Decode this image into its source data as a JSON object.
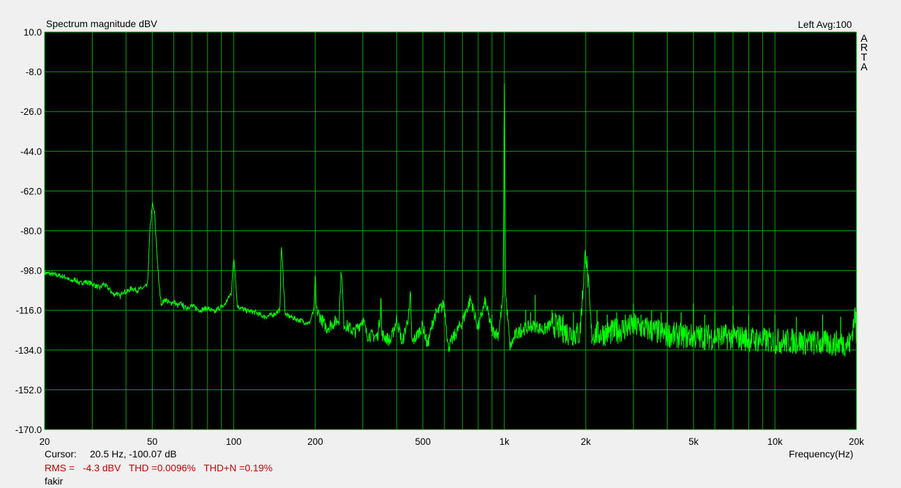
{
  "title": "Spectrum magnitude dBV",
  "channel_info": "Left  Avg:100",
  "brand": [
    "A",
    "R",
    "T",
    "A"
  ],
  "cursor_label": "Cursor:",
  "cursor_value": "20.5 Hz, -100.07 dB",
  "measurements": "RMS =   -4.3 dBV   THD =0.0096%   THD+N =0.19%",
  "comment": "fakir",
  "colors": {
    "plot_bg": "#000000",
    "grid": "#00aa00",
    "trace": "#00ff00",
    "measure_text": "#c00000"
  },
  "chart_data": {
    "type": "line",
    "xlabel": "Frequency(Hz)",
    "ylabel": "",
    "x_scale": "log",
    "xlim": [
      20,
      20000
    ],
    "ylim": [
      -170,
      10
    ],
    "grid": true,
    "y_ticks": [
      "10.0",
      "-8.0",
      "-26.0",
      "-44.0",
      "-62.0",
      "-80.0",
      "-98.0",
      "-116.0",
      "-134.0",
      "-152.0",
      "-170.0"
    ],
    "x_tick_labels": [
      {
        "value": 20,
        "label": "20"
      },
      {
        "value": 50,
        "label": "50"
      },
      {
        "value": 100,
        "label": "100"
      },
      {
        "value": 200,
        "label": "200"
      },
      {
        "value": 500,
        "label": "500"
      },
      {
        "value": 1000,
        "label": "1k"
      },
      {
        "value": 2000,
        "label": "2k"
      },
      {
        "value": 5000,
        "label": "5k"
      },
      {
        "value": 10000,
        "label": "10k"
      },
      {
        "value": 20000,
        "label": "20k"
      }
    ],
    "series": [
      {
        "points": [
          [
            20,
            -99
          ],
          [
            22,
            -100
          ],
          [
            24,
            -101
          ],
          [
            25,
            -103
          ],
          [
            26,
            -102
          ],
          [
            27,
            -104
          ],
          [
            28,
            -103
          ],
          [
            30,
            -104
          ],
          [
            32,
            -106
          ],
          [
            33,
            -104
          ],
          [
            35,
            -107
          ],
          [
            36,
            -109
          ],
          [
            37,
            -108
          ],
          [
            38,
            -110
          ],
          [
            39,
            -107
          ],
          [
            40,
            -108
          ],
          [
            42,
            -106
          ],
          [
            44,
            -107
          ],
          [
            46,
            -106
          ],
          [
            48,
            -105
          ],
          [
            49,
            -80
          ],
          [
            50,
            -68
          ],
          [
            51,
            -72
          ],
          [
            52,
            -90
          ],
          [
            53,
            -105
          ],
          [
            54,
            -113
          ],
          [
            56,
            -111
          ],
          [
            58,
            -113
          ],
          [
            60,
            -112
          ],
          [
            62,
            -114
          ],
          [
            64,
            -113
          ],
          [
            66,
            -115
          ],
          [
            70,
            -114
          ],
          [
            75,
            -116
          ],
          [
            80,
            -115
          ],
          [
            85,
            -117
          ],
          [
            88,
            -115
          ],
          [
            92,
            -114
          ],
          [
            95,
            -111
          ],
          [
            98,
            -108
          ],
          [
            100,
            -92
          ],
          [
            101,
            -97
          ],
          [
            103,
            -114
          ],
          [
            110,
            -116
          ],
          [
            120,
            -117
          ],
          [
            130,
            -119
          ],
          [
            140,
            -118
          ],
          [
            148,
            -116
          ],
          [
            150,
            -86
          ],
          [
            152,
            -99
          ],
          [
            155,
            -118
          ],
          [
            170,
            -120
          ],
          [
            190,
            -122
          ],
          [
            198,
            -116
          ],
          [
            200,
            -100
          ],
          [
            202,
            -116
          ],
          [
            220,
            -124
          ],
          [
            245,
            -120
          ],
          [
            250,
            -96
          ],
          [
            255,
            -122
          ],
          [
            280,
            -126
          ],
          [
            300,
            -120
          ],
          [
            310,
            -127
          ],
          [
            340,
            -128
          ],
          [
            348,
            -118
          ],
          [
            350,
            -107
          ],
          [
            352,
            -127
          ],
          [
            380,
            -130
          ],
          [
            400,
            -120
          ],
          [
            420,
            -131
          ],
          [
            445,
            -117
          ],
          [
            450,
            -108
          ],
          [
            455,
            -131
          ],
          [
            500,
            -123
          ],
          [
            520,
            -132
          ],
          [
            550,
            -119
          ],
          [
            600,
            -113
          ],
          [
            620,
            -133
          ],
          [
            700,
            -121
          ],
          [
            750,
            -111
          ],
          [
            800,
            -124
          ],
          [
            850,
            -112
          ],
          [
            900,
            -125
          ],
          [
            950,
            -127
          ],
          [
            990,
            -110
          ],
          [
            1000,
            -8
          ],
          [
            1010,
            -108
          ],
          [
            1050,
            -133
          ],
          [
            1100,
            -127
          ],
          [
            1200,
            -124
          ],
          [
            1300,
            -123
          ],
          [
            1400,
            -125
          ],
          [
            1500,
            -122
          ],
          [
            1700,
            -126
          ],
          [
            1900,
            -127
          ],
          [
            2000,
            -88
          ],
          [
            2100,
            -127
          ],
          [
            2500,
            -126
          ],
          [
            3000,
            -123
          ],
          [
            3500,
            -125
          ],
          [
            4000,
            -127
          ],
          [
            5000,
            -128
          ],
          [
            6000,
            -128
          ],
          [
            7000,
            -128
          ],
          [
            8000,
            -129
          ],
          [
            10000,
            -130
          ],
          [
            12000,
            -130
          ],
          [
            15000,
            -131
          ],
          [
            17000,
            -131
          ],
          [
            19000,
            -131
          ],
          [
            19800,
            -117
          ],
          [
            20000,
            -131
          ]
        ]
      }
    ],
    "peaks": [
      {
        "f": 50,
        "db": -68
      },
      {
        "f": 100,
        "db": -92
      },
      {
        "f": 150,
        "db": -86
      },
      {
        "f": 200,
        "db": -100
      },
      {
        "f": 250,
        "db": -96
      },
      {
        "f": 300,
        "db": -120
      },
      {
        "f": 350,
        "db": -107
      },
      {
        "f": 400,
        "db": -120
      },
      {
        "f": 450,
        "db": -108
      },
      {
        "f": 550,
        "db": -119
      },
      {
        "f": 600,
        "db": -113
      },
      {
        "f": 650,
        "db": -126
      },
      {
        "f": 700,
        "db": -121
      },
      {
        "f": 750,
        "db": -111
      },
      {
        "f": 800,
        "db": -124
      },
      {
        "f": 850,
        "db": -112
      },
      {
        "f": 900,
        "db": -118
      },
      {
        "f": 950,
        "db": -127
      },
      {
        "f": 1000,
        "db": -8
      },
      {
        "f": 1100,
        "db": -127
      },
      {
        "f": 1150,
        "db": -122
      },
      {
        "f": 1200,
        "db": -116
      },
      {
        "f": 1250,
        "db": -117
      },
      {
        "f": 1300,
        "db": -109
      },
      {
        "f": 1400,
        "db": -125
      },
      {
        "f": 1500,
        "db": -116
      },
      {
        "f": 1650,
        "db": -118
      },
      {
        "f": 1800,
        "db": -117
      },
      {
        "f": 2000,
        "db": -88
      },
      {
        "f": 2200,
        "db": -116
      },
      {
        "f": 2400,
        "db": -118
      },
      {
        "f": 2600,
        "db": -117
      },
      {
        "f": 2800,
        "db": -118
      },
      {
        "f": 3000,
        "db": -113
      },
      {
        "f": 3200,
        "db": -118
      },
      {
        "f": 3500,
        "db": -116
      },
      {
        "f": 3800,
        "db": -117
      },
      {
        "f": 4000,
        "db": -116
      },
      {
        "f": 4500,
        "db": -117
      },
      {
        "f": 5000,
        "db": -113
      },
      {
        "f": 5500,
        "db": -118
      },
      {
        "f": 6000,
        "db": -117
      },
      {
        "f": 7000,
        "db": -114
      },
      {
        "f": 8000,
        "db": -118
      },
      {
        "f": 10000,
        "db": -118
      },
      {
        "f": 12000,
        "db": -119
      },
      {
        "f": 15000,
        "db": -118
      },
      {
        "f": 17500,
        "db": -119
      },
      {
        "f": 20000,
        "db": -117
      }
    ],
    "noise_floor_db": -131
  }
}
